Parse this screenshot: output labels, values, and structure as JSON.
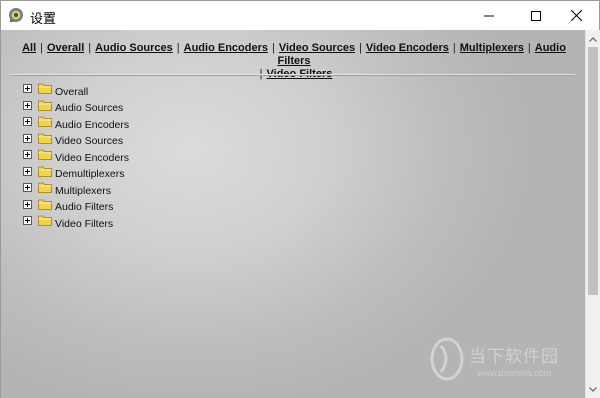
{
  "window": {
    "title": "设置",
    "minimize_label": "—",
    "maximize_label": "☐",
    "close_label": "✕"
  },
  "nav": {
    "links": [
      "All",
      "Overall",
      "Audio Sources",
      "Audio Encoders",
      "Video Sources",
      "Video Encoders",
      "Multiplexers",
      "Audio Filters",
      "Video Filters"
    ],
    "separator": "|"
  },
  "tree": {
    "items": [
      "Overall",
      "Audio Sources",
      "Audio Encoders",
      "Video Sources",
      "Video Encoders",
      "Demultiplexers",
      "Multiplexers",
      "Audio Filters",
      "Video Filters"
    ]
  },
  "watermark": {
    "brand": "当下软件园",
    "url": "www.downxia.com"
  },
  "colors": {
    "content_bg": "#cfcfcf",
    "folder": "#f0d44a",
    "link": "#111111"
  },
  "icons": {
    "app": "app-icon",
    "expander": "plus-box-icon",
    "folder": "folder-icon"
  }
}
